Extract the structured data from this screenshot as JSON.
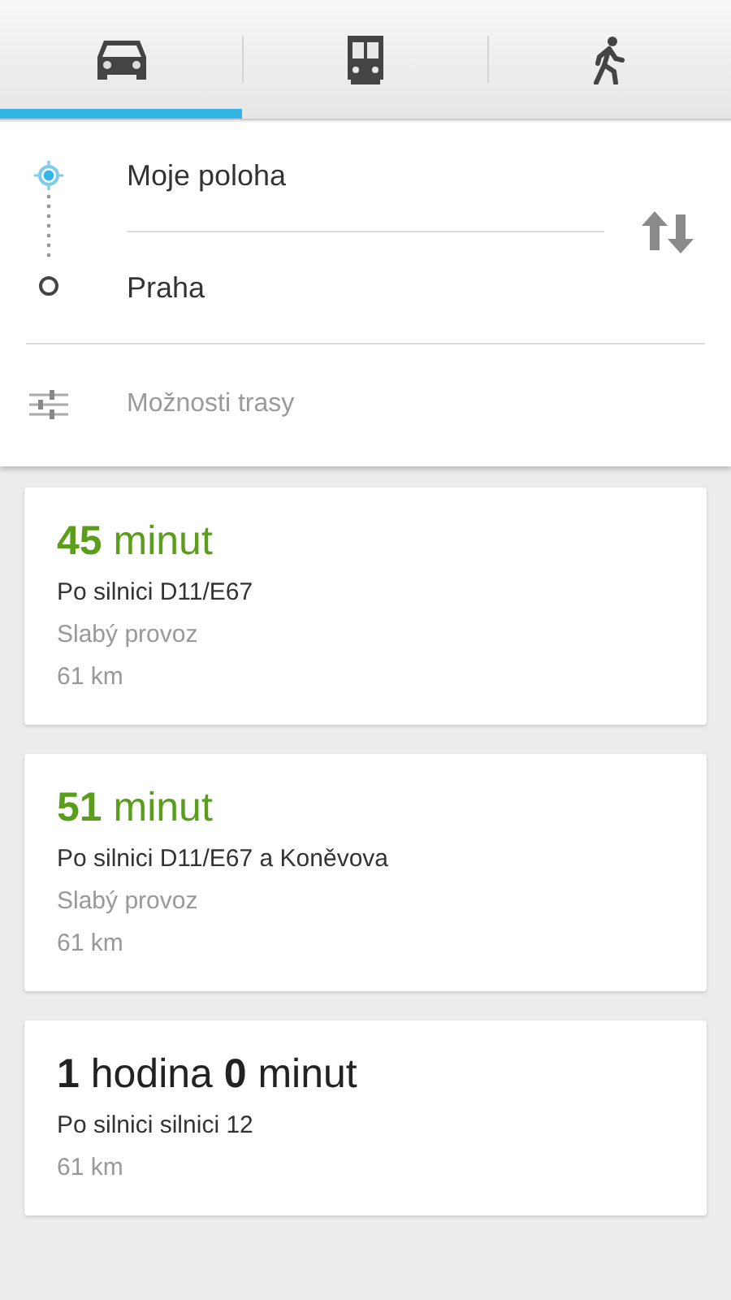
{
  "tabs": [
    {
      "kind": "car",
      "selected": true
    },
    {
      "kind": "bus",
      "selected": false
    },
    {
      "kind": "walk",
      "selected": false
    }
  ],
  "origin": {
    "value": "Moje poloha"
  },
  "destination": {
    "value": "Praha"
  },
  "route_options": "Možnosti trasy",
  "routes": [
    {
      "duration": "**45** minut",
      "color": "#5a9e1c",
      "via": "Po silnici D11/E67",
      "traffic": "Slabý provoz",
      "distance": "61 km"
    },
    {
      "duration": "**51** minut",
      "color": "#5a9e1c",
      "via": "Po silnici D11/E67 a Koněvova",
      "traffic": "Slabý provoz",
      "distance": "61 km"
    },
    {
      "duration": "**1** hodina **0** minut",
      "color": "#222222",
      "via": "Po silnici silnici 12",
      "distance": "61 km"
    }
  ]
}
